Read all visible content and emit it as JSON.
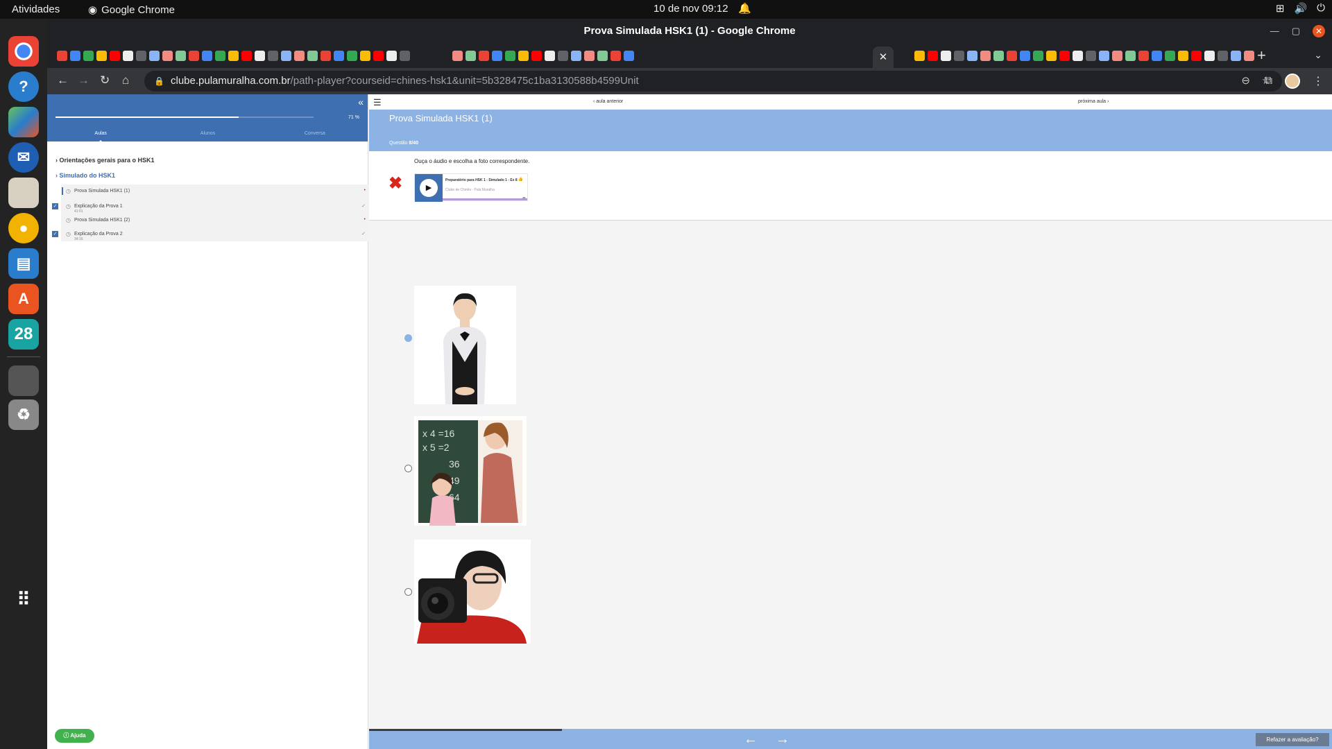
{
  "os": {
    "activities": "Atividades",
    "app_name": "Google Chrome",
    "clock": "10 de nov  09:12"
  },
  "chrome": {
    "window_title": "Prova Simulada HSK1 (1) - Google Chrome",
    "url_host": "clube.pulamuralha.com.br",
    "url_path": "/path-player?courseid=chines-hsk1&unit=5b328475c1ba3130588b4599Unit"
  },
  "sidebar": {
    "progress_percent": 71,
    "progress_label": "71 %",
    "tabs": [
      "Aulas",
      "Alunos",
      "Conversa"
    ],
    "sections": [
      "Orientações gerais para o HSK1",
      "Simulado do HSK1"
    ],
    "lessons": [
      {
        "title": "Prova Simulada HSK1 (1)",
        "duration": "",
        "status": "•"
      },
      {
        "title": "Explicação da Prova 1",
        "duration": "41:01",
        "status": "✓"
      },
      {
        "title": "Prova Simulada HSK1 (2)",
        "duration": "",
        "status": "•"
      },
      {
        "title": "Explicação da Prova 2",
        "duration": "34:16",
        "status": "✓"
      }
    ],
    "help": "Ajuda"
  },
  "lesson_nav": {
    "prev": "aula anterior",
    "next": "próxima aula"
  },
  "quiz": {
    "title": "Prova Simulada HSK1 (1)",
    "question_label": "Questão ",
    "question_number": "8/40",
    "instruction": "Ouça o áudio e escolha a foto correspondente.",
    "audio": {
      "title": "Preparatório para HSK 1 - Simulado 1 - Ex 8",
      "artist": "Clube de Chinês - Pula Muralha"
    },
    "selected_option": 1,
    "redo": "Refazer a avaliação?"
  },
  "colors": {
    "brand_blue": "#3d6fb1",
    "band_blue": "#8db3e4",
    "wrong_red": "#d9261c",
    "help_green": "#41b14d"
  }
}
